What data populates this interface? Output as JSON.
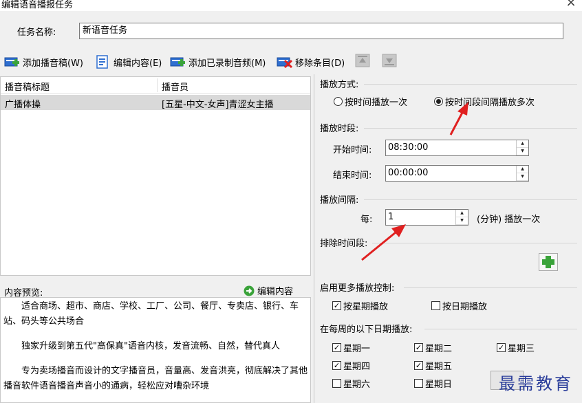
{
  "window": {
    "title": "编辑语音播报任务",
    "close_icon": "×"
  },
  "task": {
    "label": "任务名称:",
    "value": "新语音任务"
  },
  "toolbar": {
    "add_script": "添加播音稿(W)",
    "edit_content": "编辑内容(E)",
    "add_recorded": "添加已录制音频(M)",
    "remove_item": "移除条目(D)"
  },
  "list": {
    "columns": [
      "播音稿标题",
      "播音员"
    ],
    "rows": [
      {
        "title": "广播体操",
        "speaker": "[五星-中文-女声]青涩女主播"
      }
    ]
  },
  "preview": {
    "label": "内容预览:",
    "edit_label": "编辑内容",
    "paragraphs": [
      "适合商场、超市、商店、学校、工厂、公司、餐厅、专卖店、银行、车站、码头等公共场合",
      "独家升级到第五代\"高保真\"语音内核，发音流畅、自然，替代真人",
      "专为卖场播音而设计的文字播音员，音量高、发音洪亮，彻底解决了其他播音软件语音播音声音小的通病，轻松应对嘈杂环境"
    ]
  },
  "mode": {
    "title": "播放方式:",
    "option_once": "按时间播放一次",
    "option_interval": "按时间段间隔播放多次",
    "selected": "interval"
  },
  "period": {
    "title": "播放时段:",
    "start_label": "开始时间:",
    "start_value": "08:30:00",
    "end_label": "结束时间:",
    "end_value": "00:00:00"
  },
  "interval": {
    "title": "播放间隔:",
    "every_label": "每:",
    "value": "1",
    "unit_text": "(分钟) 播放一次"
  },
  "exclude": {
    "title": "排除时间段:"
  },
  "more": {
    "title": "启用更多播放控制:",
    "by_week": "按星期播放",
    "by_date": "按日期播放",
    "by_week_checked": true,
    "by_date_checked": false
  },
  "week": {
    "title": "在每周的以下日期播放:",
    "days": [
      {
        "label": "星期一",
        "checked": true
      },
      {
        "label": "星期二",
        "checked": true
      },
      {
        "label": "星期三",
        "checked": true
      },
      {
        "label": "星期四",
        "checked": true
      },
      {
        "label": "星期五",
        "checked": true
      },
      {
        "label": "星期六",
        "checked": false
      },
      {
        "label": "星期日",
        "checked": false
      }
    ]
  },
  "watermark": "最需教育",
  "colors": {
    "arrow": "#e02020",
    "watermark": "#2a3d9a",
    "selected_row": "#d9d9d9"
  }
}
